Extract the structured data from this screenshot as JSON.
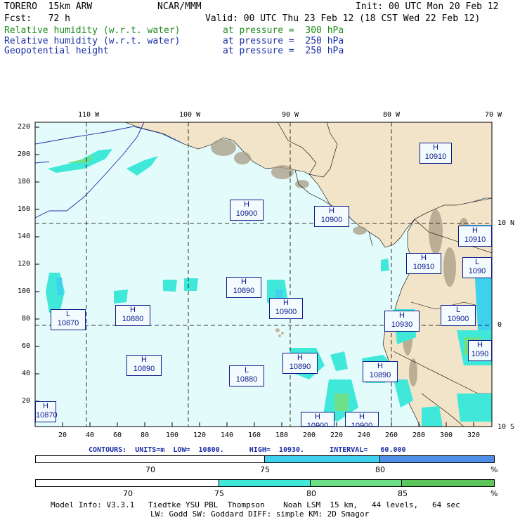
{
  "header": {
    "model": "TORERO  15km ARW",
    "org": "NCAR/MMM",
    "init": "Init: 00 UTC Mon 20 Feb 12",
    "fcst": "Fcst:   72 h",
    "valid": "Valid: 00 UTC Thu 23 Feb 12 (18 CST Wed 22 Feb 12)",
    "fields": [
      {
        "name": "Relative humidity (w.r.t. water)",
        "level": "at pressure =  300 hPa",
        "color": "#1e8c1e"
      },
      {
        "name": "Relative humidity (w.r.t. water)",
        "level": "at pressure =  250 hPa",
        "color": "#1a2ea8"
      },
      {
        "name": "Geopotential height",
        "level": "at pressure =  250 hPa",
        "color": "#1a2ea8"
      }
    ]
  },
  "axes": {
    "top_lon": [
      "110 W",
      "100 W",
      "90 W",
      "80 W",
      "70 W"
    ],
    "right_lat": [
      "10 N",
      "0",
      "10 S"
    ],
    "left_y": [
      "220",
      "200",
      "180",
      "160",
      "140",
      "120",
      "100",
      "80",
      "60",
      "40",
      "20"
    ],
    "bottom_x": [
      "20",
      "40",
      "60",
      "80",
      "100",
      "120",
      "140",
      "160",
      "180",
      "200",
      "220",
      "240",
      "260",
      "280",
      "300",
      "320"
    ]
  },
  "systems": [
    {
      "type": "H",
      "value": "10910"
    },
    {
      "type": "H",
      "value": "10900"
    },
    {
      "type": "H",
      "value": "10900"
    },
    {
      "type": "H",
      "value": "10910"
    },
    {
      "type": "H",
      "value": "10910"
    },
    {
      "type": "L",
      "value": "1090"
    },
    {
      "type": "H",
      "value": "10890"
    },
    {
      "type": "H",
      "value": "10900"
    },
    {
      "type": "L",
      "value": "10870"
    },
    {
      "type": "H",
      "value": "10880"
    },
    {
      "type": "H",
      "value": "10930"
    },
    {
      "type": "L",
      "value": "10900"
    },
    {
      "type": "H",
      "value": "10890"
    },
    {
      "type": "H",
      "value": "10890"
    },
    {
      "type": "L",
      "value": "10880"
    },
    {
      "type": "H",
      "value": "10890"
    },
    {
      "type": "H",
      "value": "1090"
    },
    {
      "type": "H",
      "value": "10870"
    },
    {
      "type": "H",
      "value": "10900"
    },
    {
      "type": "H",
      "value": "10900"
    }
  ],
  "contours_label": "CONTOURS:  UNITS=m  LOW=  10800.      HIGH=  10930.      INTERVAL=   60.000",
  "bar1": {
    "labels": [
      "70",
      "75",
      "80",
      "%"
    ],
    "colors": [
      "#ffffff",
      "#3fd2ee",
      "#4f8ee8"
    ]
  },
  "bar2": {
    "labels": [
      "70",
      "75",
      "80",
      "85",
      "%"
    ],
    "colors": [
      "#ffffff",
      "#3fe8d8",
      "#6ee08a",
      "#5cc65c"
    ]
  },
  "model_info_1": "Model Info: V3.3.1   Tiedtke YSU PBL  Thompson    Noah LSM  15 km,   44 levels,   64 sec",
  "model_info_2": "LW: Godd SW: Goddard DIFF: simple KM: 2D Smagor",
  "colors": {
    "ocean": "#e4fbfb",
    "land": "#f2e4c8",
    "terrain": "#a89c86",
    "contour": "#1a2ea8",
    "grid": "#000000"
  }
}
